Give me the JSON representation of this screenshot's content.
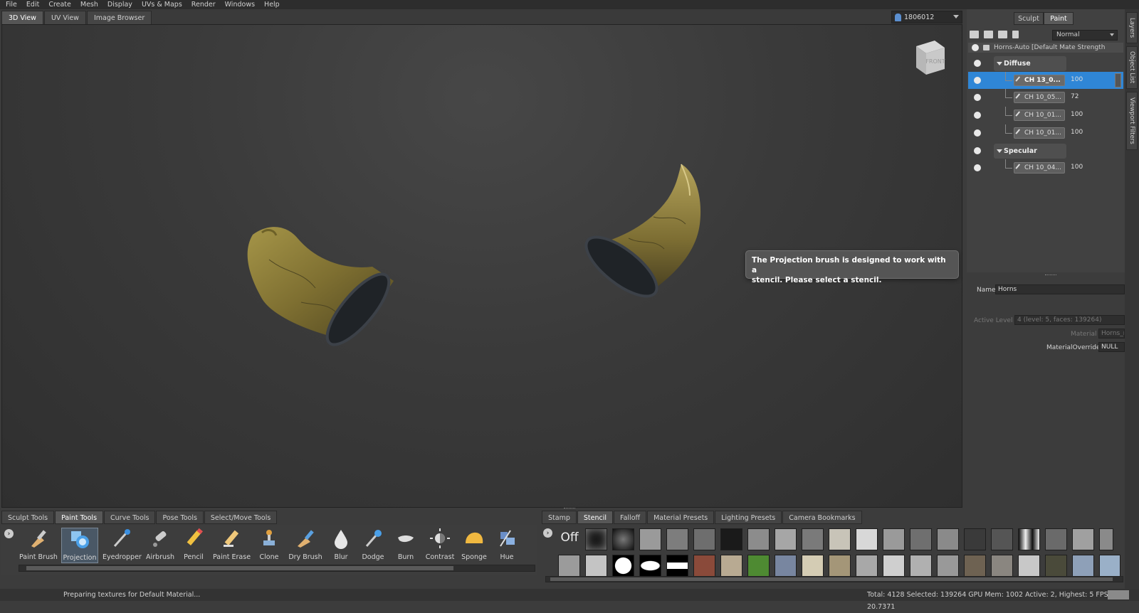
{
  "menu": [
    "File",
    "Edit",
    "Create",
    "Mesh",
    "Display",
    "UVs & Maps",
    "Render",
    "Windows",
    "Help"
  ],
  "view_tabs": [
    "3D View",
    "UV View",
    "Image Browser"
  ],
  "user": {
    "id": "1806012"
  },
  "viewcube_label": "FRONT",
  "tooltip": {
    "line1": "The Projection brush is designed to work with a",
    "line2": "stencil. Please select a stencil."
  },
  "right_panel": {
    "mode_buttons": [
      "Sculpt",
      "Paint"
    ],
    "blend_mode": "Normal",
    "object_row": "Horns-Auto [Default Mate Strength",
    "groups": [
      {
        "name": "Diffuse",
        "layers": [
          {
            "name": "CH 13_0...",
            "value": "100",
            "selected": true
          },
          {
            "name": "CH 10_05...",
            "value": "72"
          },
          {
            "name": "CH 10_01...",
            "value": "100"
          },
          {
            "name": "CH 10_01...",
            "value": "100"
          }
        ]
      },
      {
        "name": "Specular",
        "layers": [
          {
            "name": "CH 10_04...",
            "value": "100"
          }
        ]
      }
    ],
    "side_tabs": [
      "Layers",
      "Object List",
      "Viewport Filters"
    ]
  },
  "properties": {
    "name_label": "Name",
    "name_value": "Horns",
    "active_level_label": "Active Level",
    "active_level_value": "4 (level: 5, faces: 139264)",
    "material_label": "Material",
    "material_value": "Horns_mat",
    "override_label": "MaterialOverride",
    "override_value": "NULL"
  },
  "bottom_tabs": [
    "Sculpt Tools",
    "Paint Tools",
    "Curve Tools",
    "Pose Tools",
    "Select/Move Tools"
  ],
  "right_bottom_tabs": [
    "Stamp",
    "Stencil",
    "Falloff",
    "Material Presets",
    "Lighting Presets",
    "Camera Bookmarks"
  ],
  "tools": [
    "Paint Brush",
    "Projection",
    "Eyedropper",
    "Airbrush",
    "Pencil",
    "Paint Erase",
    "Clone",
    "Dry Brush",
    "Blur",
    "Dodge",
    "Burn",
    "Contrast",
    "Sponge",
    "Hue"
  ],
  "stencil_off_label": "Off",
  "status": {
    "left": "Preparing textures for Default Material...",
    "right": "Total: 4128  Selected: 139264 GPU Mem: 1002  Active: 2, Highest: 5  FPS: 20.7371"
  },
  "colors": {
    "selection": "#2f86d6",
    "horn": "#8a7a3a",
    "ring": "#1e2226"
  }
}
